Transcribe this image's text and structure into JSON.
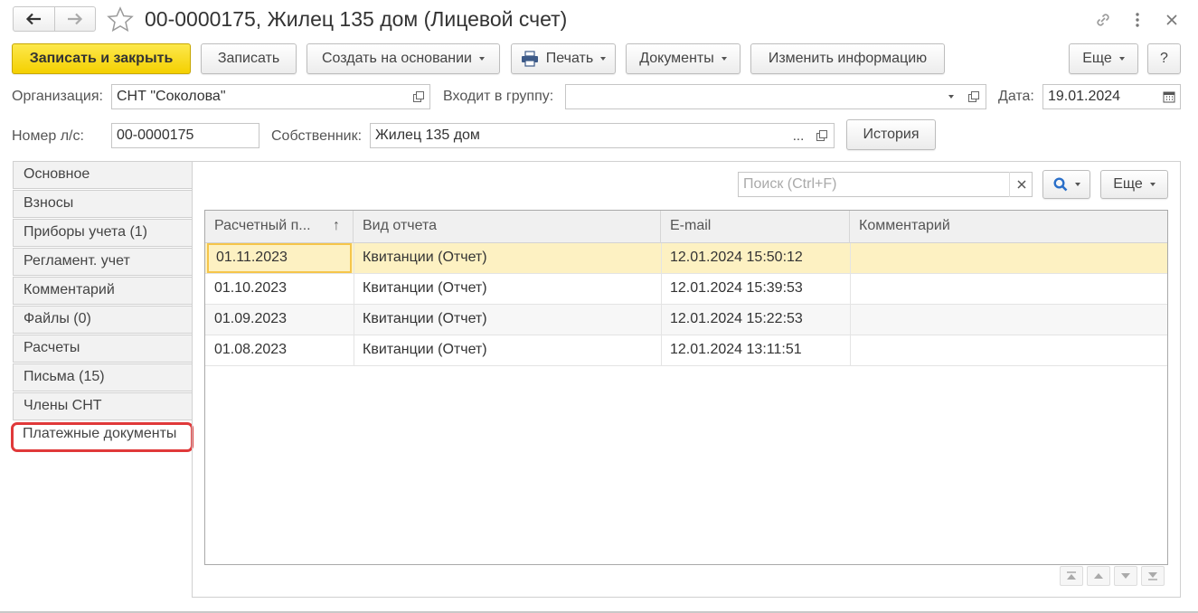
{
  "window": {
    "title": "00-0000175, Жилец 135 дом (Лицевой счет)"
  },
  "toolbar": {
    "save_close": "Записать и закрыть",
    "save": "Записать",
    "create_based": "Создать на основании",
    "print": "Печать",
    "documents": "Документы",
    "change_info": "Изменить информацию",
    "more": "Еще",
    "help": "?"
  },
  "form": {
    "org_label": "Организация:",
    "org_value": "СНТ \"Соколова\"",
    "group_label": "Входит в группу:",
    "group_value": "",
    "date_label": "Дата:",
    "date_value": "19.01.2024",
    "account_label": "Номер л/с:",
    "account_value": "00-0000175",
    "owner_label": "Собственник:",
    "owner_value": "Жилец 135 дом",
    "owner_dots": "...",
    "history": "История"
  },
  "tabs": [
    {
      "label": "Основное"
    },
    {
      "label": "Взносы"
    },
    {
      "label": "Приборы учета (1)"
    },
    {
      "label": "Регламент. учет"
    },
    {
      "label": "Комментарий"
    },
    {
      "label": "Файлы (0)"
    },
    {
      "label": "Расчеты"
    },
    {
      "label": "Письма (15)"
    },
    {
      "label": "Члены СНТ"
    },
    {
      "label": "Платежные документы",
      "active": true
    }
  ],
  "panel": {
    "search_placeholder": "Поиск (Ctrl+F)",
    "more": "Еще"
  },
  "table": {
    "columns": [
      "Расчетный п...",
      "Вид отчета",
      "E-mail",
      "Комментарий"
    ],
    "sort_indicator": "↑",
    "rows": [
      {
        "period": "01.11.2023",
        "type": "Квитанции (Отчет)",
        "email": "12.01.2024 15:50:12",
        "comment": ""
      },
      {
        "period": "01.10.2023",
        "type": "Квитанции (Отчет)",
        "email": "12.01.2024 15:39:53",
        "comment": ""
      },
      {
        "period": "01.09.2023",
        "type": "Квитанции (Отчет)",
        "email": "12.01.2024 15:22:53",
        "comment": ""
      },
      {
        "period": "01.08.2023",
        "type": "Квитанции (Отчет)",
        "email": "12.01.2024 13:11:51",
        "comment": ""
      }
    ]
  },
  "colors": {
    "primary_button": "#f4d000",
    "selected_row": "#fdf1c2",
    "highlight_border": "#e0393a"
  }
}
